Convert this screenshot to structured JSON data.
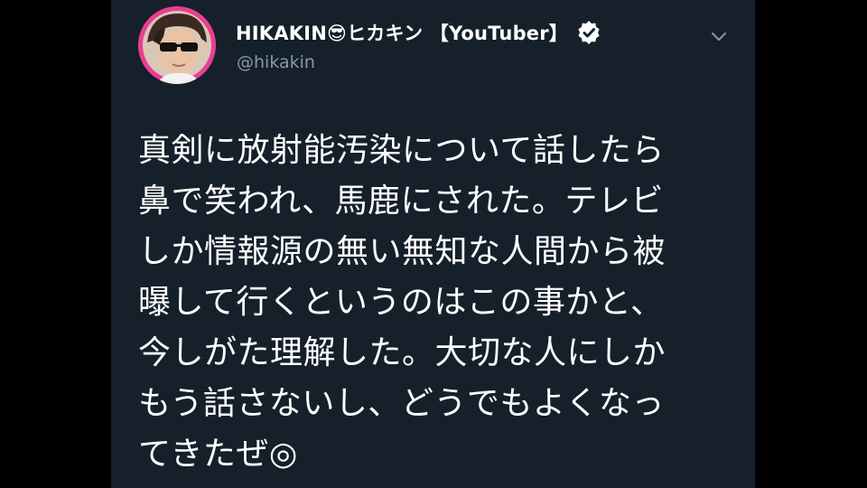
{
  "account": {
    "display_name": "HIKAKIN😎ヒカキン 【YouTuber】",
    "handle": "@hikakin",
    "verified": true,
    "avatar_ring_color": "#ea3e92"
  },
  "tweet": {
    "lines": [
      "真剣に放射能汚染について話したら",
      "鼻で笑われ、馬鹿にされた。テレビ",
      "しか情報源の無い無知な人間から被",
      "曝して行くというのはこの事かと、",
      "今しがた理解した。大切な人にしか",
      "もう話さないし、どうでもよくなっ",
      "てきたぜ◎"
    ]
  },
  "icons": {
    "verified": "verified-badge-icon",
    "menu": "chevron-down-icon"
  },
  "colors": {
    "card_background": "#15202b",
    "outer_background": "#000000",
    "text_primary": "#ffffff",
    "text_secondary": "#8899a6"
  }
}
